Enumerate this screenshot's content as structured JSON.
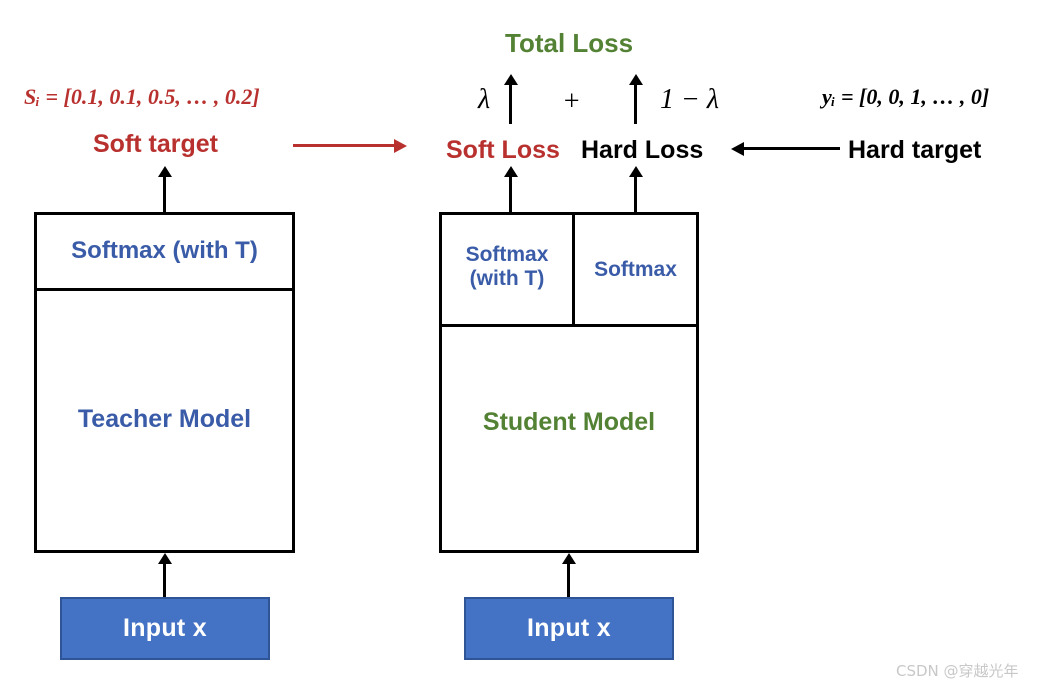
{
  "diagram": {
    "title_total_loss": "Total Loss",
    "colors": {
      "red": "#B8312F",
      "green": "#548235",
      "blue": "#3A5CA8",
      "black": "#000000",
      "input_fill": "#4472C4",
      "input_border": "#2F5597",
      "watermark": "#c8c8c8"
    },
    "teacher": {
      "soft_target_formula": "Sᵢ = [0.1, 0.1, 0.5, … , 0.2]",
      "soft_target_label": "Soft target",
      "softmax_label": "Softmax (with T)",
      "model_label": "Teacher Model",
      "input_label": "Input x"
    },
    "student": {
      "softmax_t_label_line1": "Softmax",
      "softmax_t_label_line2": "(with T)",
      "softmax_label": "Softmax",
      "model_label": "Student Model",
      "input_label": "Input x"
    },
    "loss": {
      "soft_loss_label": "Soft Loss",
      "hard_loss_label": "Hard Loss",
      "lambda_left": "λ",
      "plus_sign": "+",
      "lambda_right": "1 − λ"
    },
    "hard_target": {
      "formula": "yᵢ = [0, 0, 1, … , 0]",
      "label": "Hard target"
    },
    "watermark": "CSDN @穿越光年"
  }
}
